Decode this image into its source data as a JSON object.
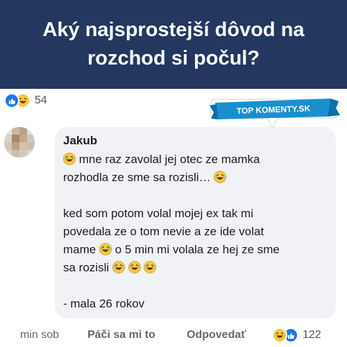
{
  "header": {
    "title": "Aký najsprostejší dôvod na rozchod si počul?",
    "background": "#24375e"
  },
  "top_reactions": {
    "icons": [
      "like-icon",
      "laugh-icon"
    ],
    "count": "54"
  },
  "badge": {
    "text": "TOP KOMENTY.SK",
    "color": "#1a8fd0"
  },
  "comment": {
    "author": "Jakub",
    "lines": {
      "l1": "mne raz zavolal jej otec ze mamka",
      "l2": "rozhodla ze sme sa rozisli… ",
      "l3": "ked som potom volal mojej ex tak mi",
      "l4": "povedala ze o tom nevie a ze ide volat",
      "l5a": "mame ",
      "l5b": "  o 5 min mi volala ze hej ze sme",
      "l6": "sa rozisli ",
      "l7": "- mala 26 rokov"
    }
  },
  "footer": {
    "time": "min sob",
    "like_label": "Páči sa mi to",
    "reply_label": "Odpovedať",
    "reaction_icons": [
      "laugh-icon",
      "like-icon"
    ],
    "reaction_count": "122"
  }
}
